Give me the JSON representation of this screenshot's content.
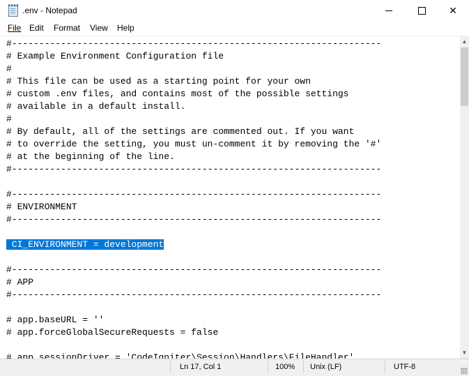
{
  "window": {
    "title": ".env - Notepad",
    "minimize_label": "",
    "maximize_label": "",
    "close_label": "✕"
  },
  "menu": {
    "items": [
      "File",
      "Edit",
      "Format",
      "View",
      "Help"
    ]
  },
  "editor": {
    "lines": [
      "#--------------------------------------------------------------------",
      "# Example Environment Configuration file",
      "#",
      "# This file can be used as a starting point for your own",
      "# custom .env files, and contains most of the possible settings",
      "# available in a default install.",
      "#",
      "# By default, all of the settings are commented out. If you want",
      "# to override the setting, you must un-comment it by removing the '#'",
      "# at the beginning of the line.",
      "#--------------------------------------------------------------------",
      "",
      "#--------------------------------------------------------------------",
      "# ENVIRONMENT",
      "#--------------------------------------------------------------------",
      "",
      " CI_ENVIRONMENT = development",
      "",
      "#--------------------------------------------------------------------",
      "# APP",
      "#--------------------------------------------------------------------",
      "",
      "# app.baseURL = ''",
      "# app.forceGlobalSecureRequests = false",
      "",
      "# app.sessionDriver = 'CodeIgniter\\Session\\Handlers\\FileHandler'"
    ],
    "selected_line_index": 16
  },
  "statusbar": {
    "position": "Ln 17, Col 1",
    "zoom": "100%",
    "line_ending": "Unix (LF)",
    "encoding": "UTF-8"
  },
  "colors": {
    "selection": "#0078d7",
    "statusbar_bg": "#f0f0f0"
  }
}
